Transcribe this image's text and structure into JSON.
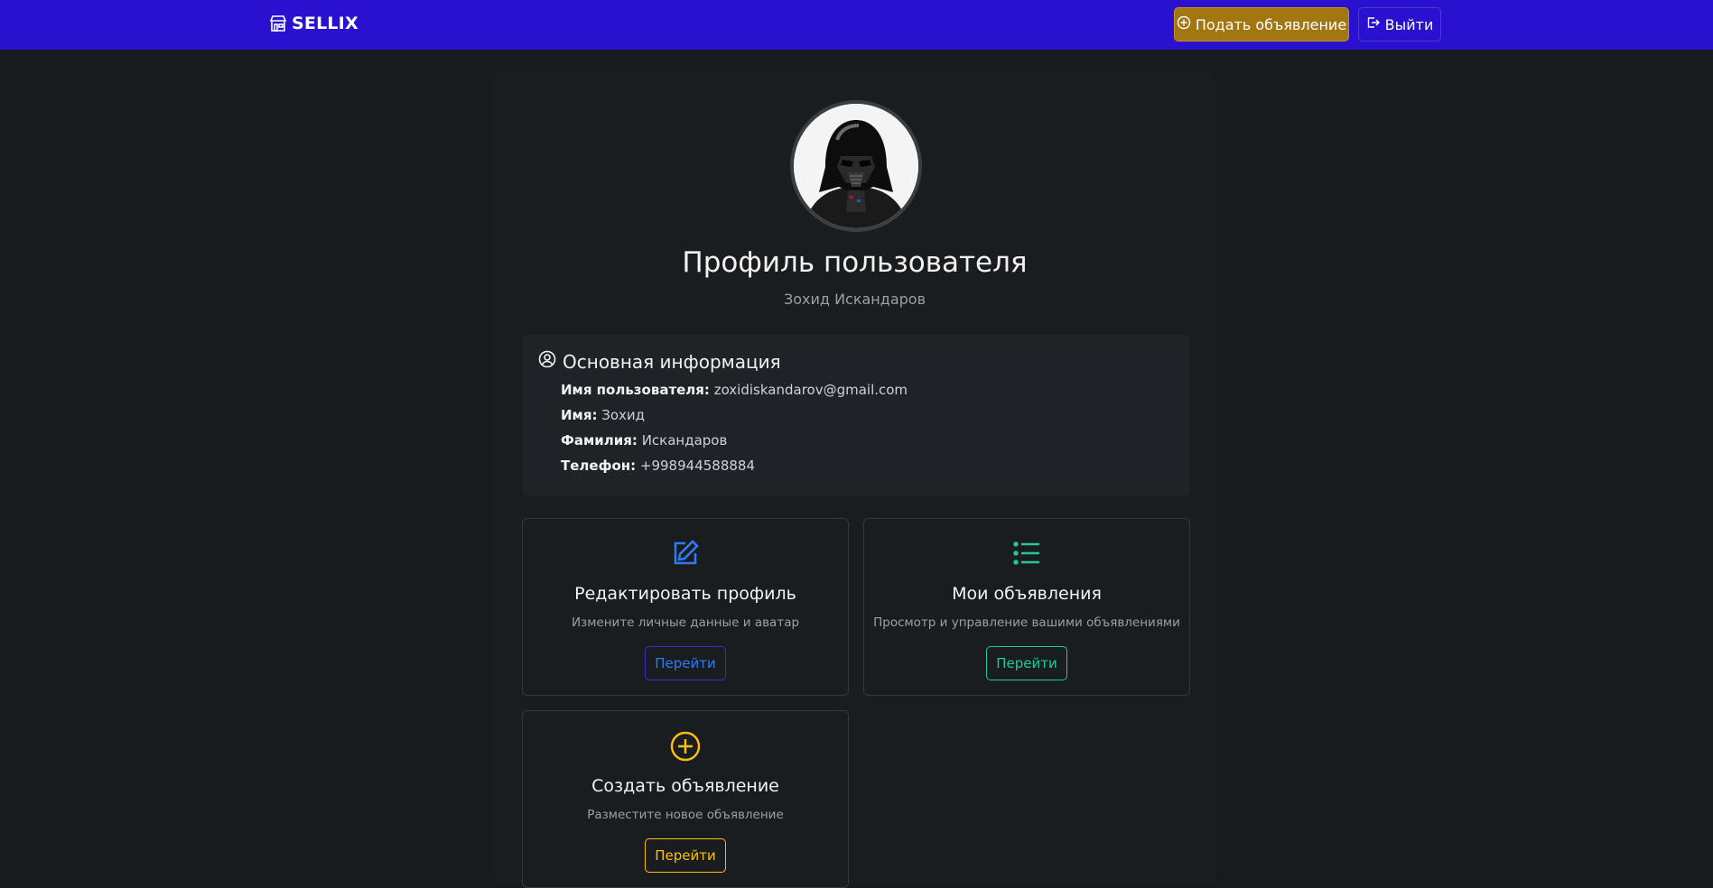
{
  "navbar": {
    "brand": "SELLIX",
    "post_button": "Подать объявление",
    "logout_button": "Выйти",
    "brand_color": "#2a10cf",
    "post_color": "#a27611"
  },
  "profile": {
    "title": "Профиль пользователя",
    "full_name": "Зохид Искандаров"
  },
  "info": {
    "heading": "Основная информация",
    "rows": [
      {
        "label": "Имя пользователя:",
        "value": "zoxidiskandarov@gmail.com"
      },
      {
        "label": "Имя:",
        "value": "Зохид"
      },
      {
        "label": "Фамилия:",
        "value": "Искандаров"
      },
      {
        "label": "Телефон:",
        "value": "+998944588884"
      }
    ]
  },
  "features": [
    {
      "title": "Редактировать профиль",
      "desc": "Измените личные данные и аватар",
      "button": "Перейти",
      "icon": "edit-icon",
      "color": "#2f7bf5"
    },
    {
      "title": "Мои объявления",
      "desc": "Просмотр и управление вашими объявлениями",
      "button": "Перейти",
      "icon": "list-icon",
      "color": "#20c997"
    },
    {
      "title": "Создать объявление",
      "desc": "Разместите новое объявление",
      "button": "Перейти",
      "icon": "plus-circle-icon",
      "color": "#ffc107"
    }
  ]
}
